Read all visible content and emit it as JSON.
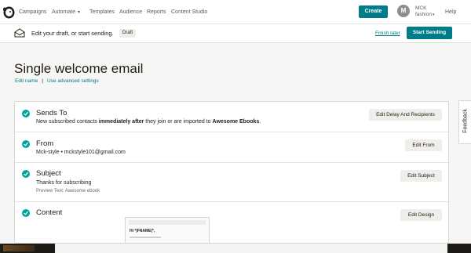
{
  "nav": {
    "items": [
      "Campaigns",
      "Automate",
      "Templates",
      "Audience",
      "Reports",
      "Content Studio"
    ],
    "create_label": "Create",
    "avatar_initial": "M",
    "account_line1": "MCK",
    "account_line2": "fashion",
    "help_label": "Help"
  },
  "draft_bar": {
    "title": "Edit your draft, or start sending.",
    "badge": "Draft",
    "finish_later": "Finish later",
    "start_sending": "Start Sending"
  },
  "page": {
    "title": "Single welcome email",
    "link_edit_name": "Edit name",
    "separator": "|",
    "link_advanced": "Use advanced settings"
  },
  "checklist": {
    "sends_to": {
      "title": "Sends To",
      "desc_1": "New subscribed contacts ",
      "desc_bold_1": "immediately after",
      "desc_2": " they join or are imported to ",
      "desc_bold_2": "Awesome Ebooks",
      "desc_3": ".",
      "button": "Edit Delay And Recipients"
    },
    "from": {
      "title": "From",
      "desc": "Mck-style • mckstyle101@gmail.com",
      "button": "Edit From"
    },
    "subject": {
      "title": "Subject",
      "desc": "Thanks for subscribing",
      "preview_text": "Preview Text: Awesome ebook",
      "button": "Edit Subject"
    },
    "content": {
      "title": "Content",
      "button": "Edit Design",
      "preview_greeting": "Hi *|FNAME|*,"
    }
  },
  "feedback_label": "Feedback",
  "colors": {
    "accent": "#007c89",
    "check": "#00a39d"
  }
}
